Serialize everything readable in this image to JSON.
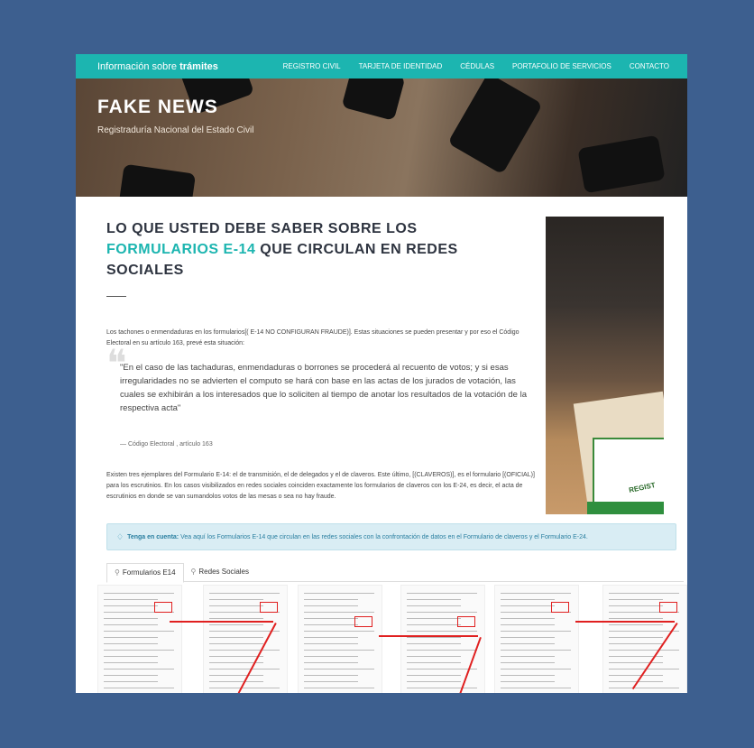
{
  "nav": {
    "brand_prefix": "Información sobre",
    "brand_bold": "trámites",
    "links": [
      "REGISTRO CIVIL",
      "TARJETA DE IDENTIDAD",
      "CÉDULAS",
      "PORTAFOLIO DE SERVICIOS",
      "CONTACTO"
    ]
  },
  "hero": {
    "title": "FAKE NEWS",
    "subtitle": "Registraduría Nacional del Estado Civil"
  },
  "article": {
    "headline_part1": "LO QUE USTED DEBE SABER SOBRE LOS",
    "headline_teal": "FORMULARIOS E-14",
    "headline_part2": "QUE CIRCULAN EN REDES SOCIALES",
    "paragraph1": "Los tachones o enmendaduras en los formularios[( E-14 NO CONFIGURAN FRAUDE)]. Estas situaciones se pueden presentar y por eso el Código Electoral en su artículo 163, prevé esta situación:",
    "quote": "\"En el caso de las tachaduras, enmendaduras o borrones se procederá al recuento de votos; y si esas irregularidades no se advierten el computo se hará con base en las actas de los jurados de votación, las cuales se exhibirán a los interesados que lo soliciten al tiempo de anotar los resultados de la votación de la respectiva acta\"",
    "quote_cite": "— Código Electoral , artículo 163",
    "paragraph2": "Existen tres ejemplares del Formulario E-14: el de transmisión, el de delegados y el de claveros. Este último, [(CLAVEROS)], es el formulario [(OFICIAL)] para los escrutinios. En los casos visibilizados en redes sociales coinciden exactamente los formularios de claveros con los E-24, es decir, el acta de escrutinios en donde se van sumandolos votos de las mesas o sea no hay fraude."
  },
  "side_photo": {
    "box_text": "REGIST"
  },
  "alert": {
    "icon": "lightbulb-icon",
    "bold": "Tenga en cuenta:",
    "text": "Vea aquí los Formularios E-14 que circulan en las redes sociales con la confrontación de datos en el Formulario de claveros y el Formulario E-24."
  },
  "tabs": [
    {
      "label": "Formularios E14",
      "icon": "user-icon",
      "active": true
    },
    {
      "label": "Redes Sociales",
      "icon": "user-icon",
      "active": false
    }
  ],
  "colors": {
    "teal": "#1cb5b0",
    "page_bg": "#3d5f8f",
    "highlight_red": "#e02020"
  }
}
